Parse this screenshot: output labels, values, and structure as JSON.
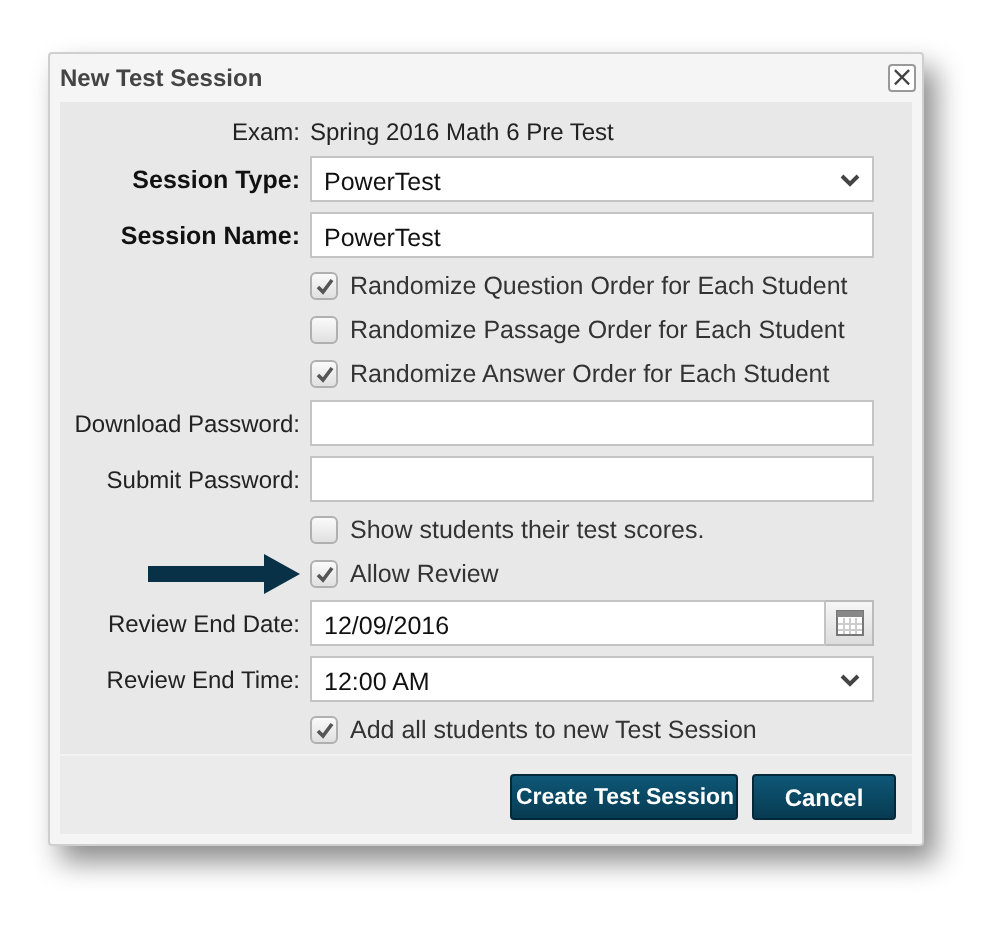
{
  "dialog": {
    "title": "New Test Session",
    "close": "×"
  },
  "rows": [
    {
      "kind": "text",
      "label": "Exam:",
      "bold": false,
      "value": "Spring 2016 Math 6 Pre Test"
    },
    {
      "kind": "select",
      "label": "Session Type:",
      "bold": true,
      "value": "PowerTest"
    },
    {
      "kind": "input",
      "label": "Session Name:",
      "bold": true,
      "value": "PowerTest"
    },
    {
      "kind": "checkbox",
      "label": "Randomize Question Order for Each Student",
      "checked": true
    },
    {
      "kind": "checkbox",
      "label": "Randomize Passage Order for Each Student",
      "checked": false
    },
    {
      "kind": "checkbox",
      "label": "Randomize Answer Order for Each Student",
      "checked": true
    },
    {
      "kind": "input",
      "label": "Download Password:",
      "bold": false,
      "value": ""
    },
    {
      "kind": "input",
      "label": "Submit Password:",
      "bold": false,
      "value": ""
    },
    {
      "kind": "checkbox",
      "label": "Show students their test scores.",
      "checked": false
    },
    {
      "kind": "checkbox",
      "label": "Allow Review",
      "checked": true,
      "pointer": true
    },
    {
      "kind": "date",
      "label": "Review End Date:",
      "bold": false,
      "value": "12/09/2016"
    },
    {
      "kind": "select",
      "label": "Review End Time:",
      "bold": false,
      "value": "12:00 AM"
    },
    {
      "kind": "checkbox",
      "label": "Add all students to new Test Session",
      "checked": true
    }
  ],
  "buttons": [
    "Create Test Session",
    "Cancel"
  ]
}
